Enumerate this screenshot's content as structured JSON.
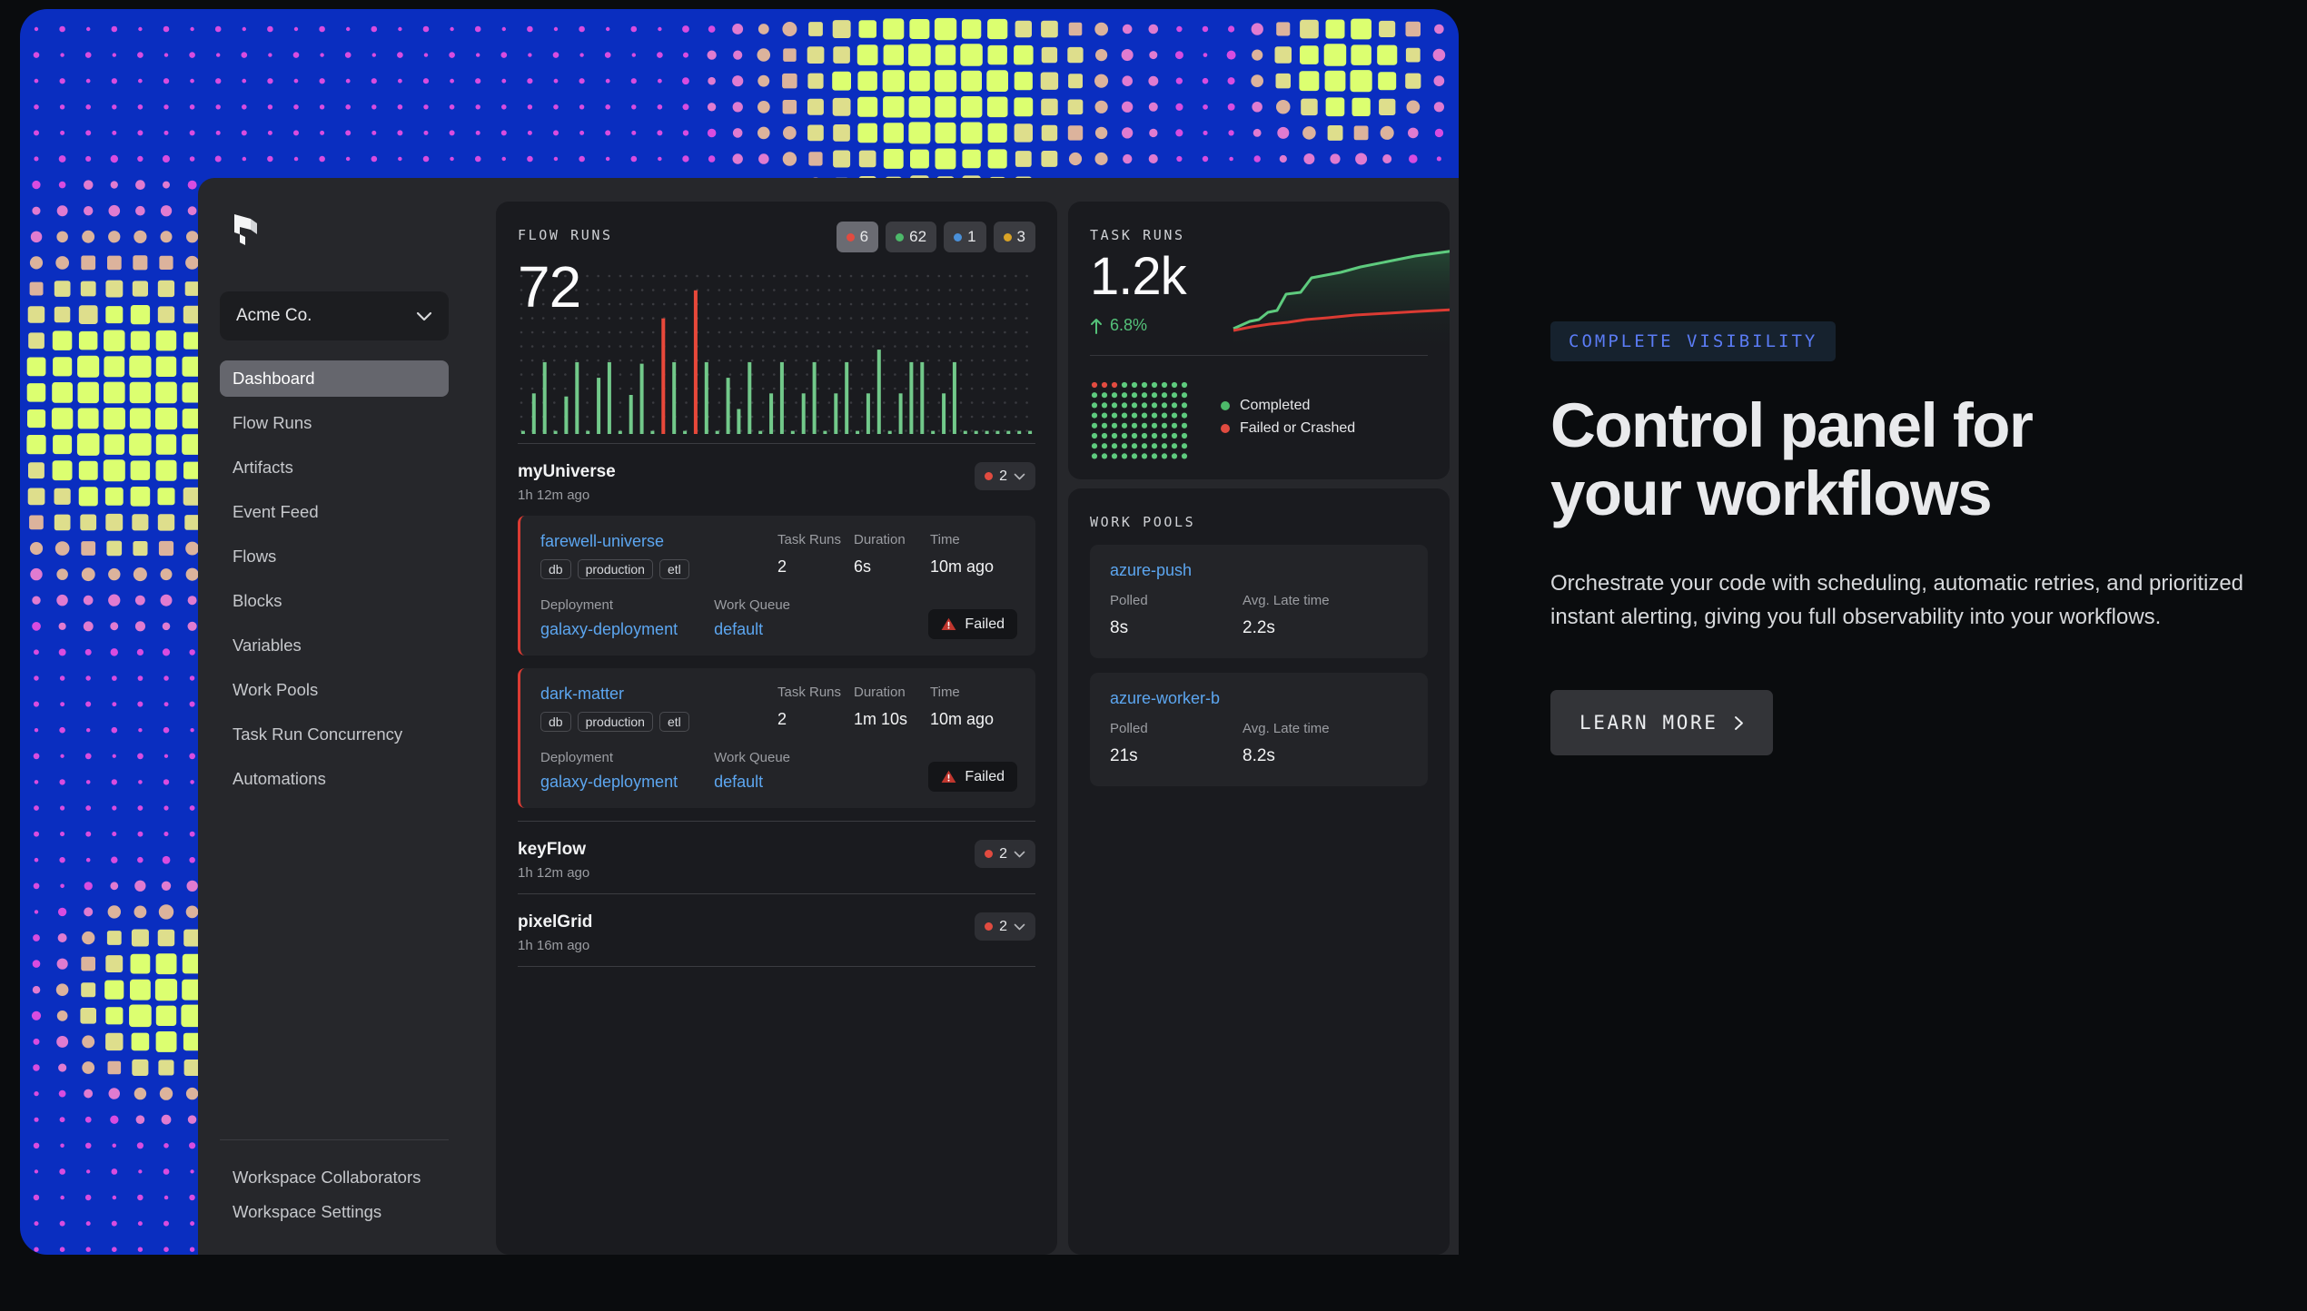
{
  "decor": {
    "panel_color": "#0a2ec0",
    "dot_colors": [
      "#d84ce0",
      "#e07bd0",
      "#dcb39c",
      "#dede8c",
      "#dcff70"
    ]
  },
  "app": {
    "logo": "prefect-logo-icon",
    "sidebar": {
      "org_select": {
        "value": "Acme Co.",
        "chevron": "chevron-down-icon"
      },
      "items": [
        {
          "label": "Dashboard",
          "active": true
        },
        {
          "label": "Flow Runs",
          "active": false
        },
        {
          "label": "Artifacts",
          "active": false
        },
        {
          "label": "Event Feed",
          "active": false
        },
        {
          "label": "Flows",
          "active": false
        },
        {
          "label": "Blocks",
          "active": false
        },
        {
          "label": "Variables",
          "active": false
        },
        {
          "label": "Work Pools",
          "active": false
        },
        {
          "label": "Task Run Concurrency",
          "active": false
        },
        {
          "label": "Automations",
          "active": false
        }
      ],
      "footer_items": [
        {
          "label": "Workspace Collaborators"
        },
        {
          "label": "Workspace Settings"
        }
      ]
    },
    "flow_runs": {
      "label": "FLOW RUNS",
      "total": "72",
      "chips": [
        {
          "count": "6",
          "color": "#e14b40",
          "selected": true
        },
        {
          "count": "62",
          "color": "#4db96a",
          "selected": false
        },
        {
          "count": "1",
          "color": "#4a90d9",
          "selected": false
        },
        {
          "count": "3",
          "color": "#d9a326",
          "selected": false
        }
      ],
      "groups": [
        {
          "name": "myUniverse",
          "time": "1h 12m ago",
          "count": "2",
          "count_color": "#e14b40",
          "chevron": "chevron-down-icon",
          "runs": [
            {
              "name": "farewell-universe",
              "tags": [
                "db",
                "production",
                "etl"
              ],
              "metrics": [
                {
                  "label": "Task Runs",
                  "value": "2"
                },
                {
                  "label": "Duration",
                  "value": "6s"
                },
                {
                  "label": "Time",
                  "value": "10m ago"
                }
              ],
              "deployment_label": "Deployment",
              "deployment_value": "galaxy-deployment",
              "workqueue_label": "Work Queue",
              "workqueue_value": "default",
              "state": "Failed",
              "state_icon": "warning-triangle-icon",
              "state_color": "#db3b33"
            },
            {
              "name": "dark-matter",
              "tags": [
                "db",
                "production",
                "etl"
              ],
              "metrics": [
                {
                  "label": "Task Runs",
                  "value": "2"
                },
                {
                  "label": "Duration",
                  "value": "1m 10s"
                },
                {
                  "label": "Time",
                  "value": "10m ago"
                }
              ],
              "deployment_label": "Deployment",
              "deployment_value": "galaxy-deployment",
              "workqueue_label": "Work Queue",
              "workqueue_value": "default",
              "state": "Failed",
              "state_icon": "warning-triangle-icon",
              "state_color": "#db3b33"
            }
          ]
        },
        {
          "name": "keyFlow",
          "time": "1h 12m ago",
          "count": "2",
          "count_color": "#e14b40",
          "chevron": "chevron-down-icon",
          "runs": []
        },
        {
          "name": "pixelGrid",
          "time": "1h 16m ago",
          "count": "2",
          "count_color": "#e14b40",
          "chevron": "chevron-down-icon",
          "runs": []
        }
      ]
    },
    "task_runs": {
      "label": "TASK RUNS",
      "total": "1.2k",
      "delta": "6.8%",
      "delta_icon": "arrow-up-icon",
      "delta_color": "#54c179",
      "legend": [
        {
          "label": "Completed",
          "color": "#4db96a"
        },
        {
          "label": "Failed or Crashed",
          "color": "#e14b40"
        }
      ],
      "grid": {
        "columns": 10,
        "rows": 8,
        "failed": 3
      }
    },
    "work_pools": {
      "label": "WORK POOLS",
      "pools": [
        {
          "name": "azure-push",
          "polled_label": "Polled",
          "polled_value": "8s",
          "late_label": "Avg. Late time",
          "late_value": "2.2s"
        },
        {
          "name": "azure-worker-b",
          "polled_label": "Polled",
          "polled_value": "21s",
          "late_label": "Avg. Late time",
          "late_value": "8.2s"
        }
      ]
    }
  },
  "marketing": {
    "eyebrow": "COMPLETE VISIBILITY",
    "headline_line1": "Control panel for",
    "headline_line2": "your workflows",
    "subcopy": "Orchestrate your code with scheduling, automatic retries, and prioritized instant alerting, giving you full observability into your workflows.",
    "cta_label": "LEARN MORE",
    "cta_icon": "chevron-right-icon"
  },
  "chart_data": [
    {
      "type": "bar",
      "title": "Flow Runs",
      "xlabel": "",
      "ylabel": "",
      "ylim": [
        0,
        100
      ],
      "grid": true,
      "legend": "none",
      "categories": [
        "1",
        "2",
        "3",
        "4",
        "5",
        "6",
        "7",
        "8",
        "9",
        "10",
        "11",
        "12",
        "13",
        "14",
        "15",
        "16",
        "17",
        "18",
        "19",
        "20",
        "21",
        "22",
        "23",
        "24",
        "25",
        "26",
        "27",
        "28",
        "29",
        "30",
        "31",
        "32",
        "33",
        "34",
        "35",
        "36",
        "37",
        "38",
        "39",
        "40",
        "41",
        "42",
        "43",
        "44",
        "45",
        "46",
        "47",
        "48"
      ],
      "values": [
        2,
        26,
        46,
        2,
        24,
        46,
        2,
        36,
        46,
        2,
        25,
        45,
        2,
        74,
        46,
        2,
        92,
        46,
        2,
        36,
        16,
        46,
        2,
        26,
        46,
        2,
        26,
        46,
        2,
        26,
        46,
        2,
        26,
        54,
        2,
        26,
        46,
        46,
        2,
        26,
        46,
        2,
        2,
        2,
        2,
        2,
        2,
        2
      ],
      "colors": [
        "#72c98a",
        "#72c98a",
        "#72c98a",
        "#72c98a",
        "#72c98a",
        "#72c98a",
        "#72c98a",
        "#72c98a",
        "#72c98a",
        "#72c98a",
        "#72c98a",
        "#72c98a",
        "#72c98a",
        "#e8483a",
        "#72c98a",
        "#72c98a",
        "#e8483a",
        "#72c98a",
        "#72c98a",
        "#72c98a",
        "#72c98a",
        "#72c98a",
        "#72c98a",
        "#72c98a",
        "#72c98a",
        "#72c98a",
        "#72c98a",
        "#72c98a",
        "#72c98a",
        "#72c98a",
        "#72c98a",
        "#72c98a",
        "#72c98a",
        "#72c98a",
        "#72c98a",
        "#72c98a",
        "#72c98a",
        "#72c98a",
        "#72c98a",
        "#72c98a",
        "#72c98a",
        "#72c98a",
        "#72c98a",
        "#72c98a",
        "#72c98a",
        "#72c98a",
        "#72c98a",
        "#72c98a"
      ]
    },
    {
      "type": "area",
      "title": "Task Runs sparkline",
      "xlabel": "",
      "ylabel": "",
      "series": [
        {
          "name": "Completed",
          "color": "#5ecb7e",
          "values": [
            8,
            14,
            17,
            22,
            24,
            33,
            36,
            46,
            56,
            60,
            63,
            68,
            72,
            76
          ]
        },
        {
          "name": "Failed or Crashed",
          "color": "#db3b33",
          "values": [
            6,
            9,
            11,
            13,
            14,
            16,
            17,
            19,
            20,
            21,
            22,
            23,
            24,
            25
          ]
        }
      ]
    },
    {
      "type": "heatmap",
      "title": "Task run outcome grid",
      "columns": 10,
      "rows": 8,
      "legend": [
        "Completed",
        "Failed or Crashed"
      ],
      "failed_count": 3,
      "completed_count": 77
    }
  ]
}
